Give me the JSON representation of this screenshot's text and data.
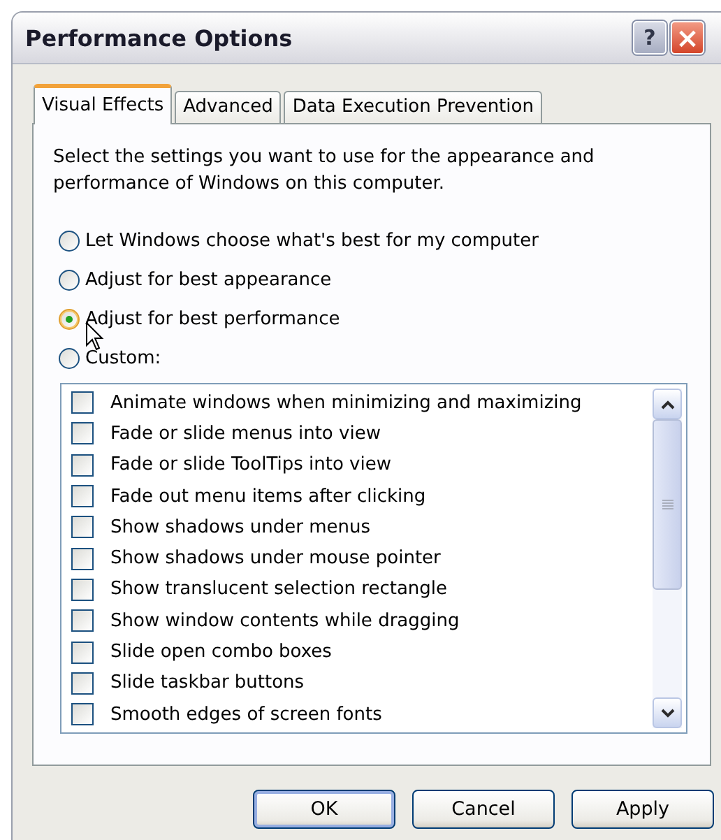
{
  "window": {
    "title": "Performance Options",
    "title_buttons": [
      "?",
      "×"
    ]
  },
  "tabs": [
    {
      "label": "Visual Effects",
      "selected": true
    },
    {
      "label": "Advanced",
      "selected": false
    },
    {
      "label": "Data Execution Prevention",
      "selected": false
    }
  ],
  "description": "Select the settings you want to use for the appearance and performance of Windows on this computer.",
  "options": [
    {
      "label": "Let Windows choose what's best for my computer",
      "selected": false
    },
    {
      "label": "Adjust for best appearance",
      "selected": false
    },
    {
      "label": "Adjust for best performance",
      "selected": true
    },
    {
      "label": "Custom:",
      "selected": false
    }
  ],
  "effects": [
    {
      "label": "Animate windows when minimizing and maximizing",
      "checked": false
    },
    {
      "label": "Fade or slide menus into view",
      "checked": false
    },
    {
      "label": "Fade or slide ToolTips into view",
      "checked": false
    },
    {
      "label": "Fade out menu items after clicking",
      "checked": false
    },
    {
      "label": "Show shadows under menus",
      "checked": false
    },
    {
      "label": "Show shadows under mouse pointer",
      "checked": false
    },
    {
      "label": "Show translucent selection rectangle",
      "checked": false
    },
    {
      "label": "Show window contents while dragging",
      "checked": false
    },
    {
      "label": "Slide open combo boxes",
      "checked": false
    },
    {
      "label": "Slide taskbar buttons",
      "checked": false
    },
    {
      "label": "Smooth edges of screen fonts",
      "checked": false
    }
  ],
  "buttons": [
    {
      "label": "OK",
      "kind": "default"
    },
    {
      "label": "Cancel",
      "kind": "normal"
    },
    {
      "label": "Apply",
      "kind": "normal"
    }
  ]
}
